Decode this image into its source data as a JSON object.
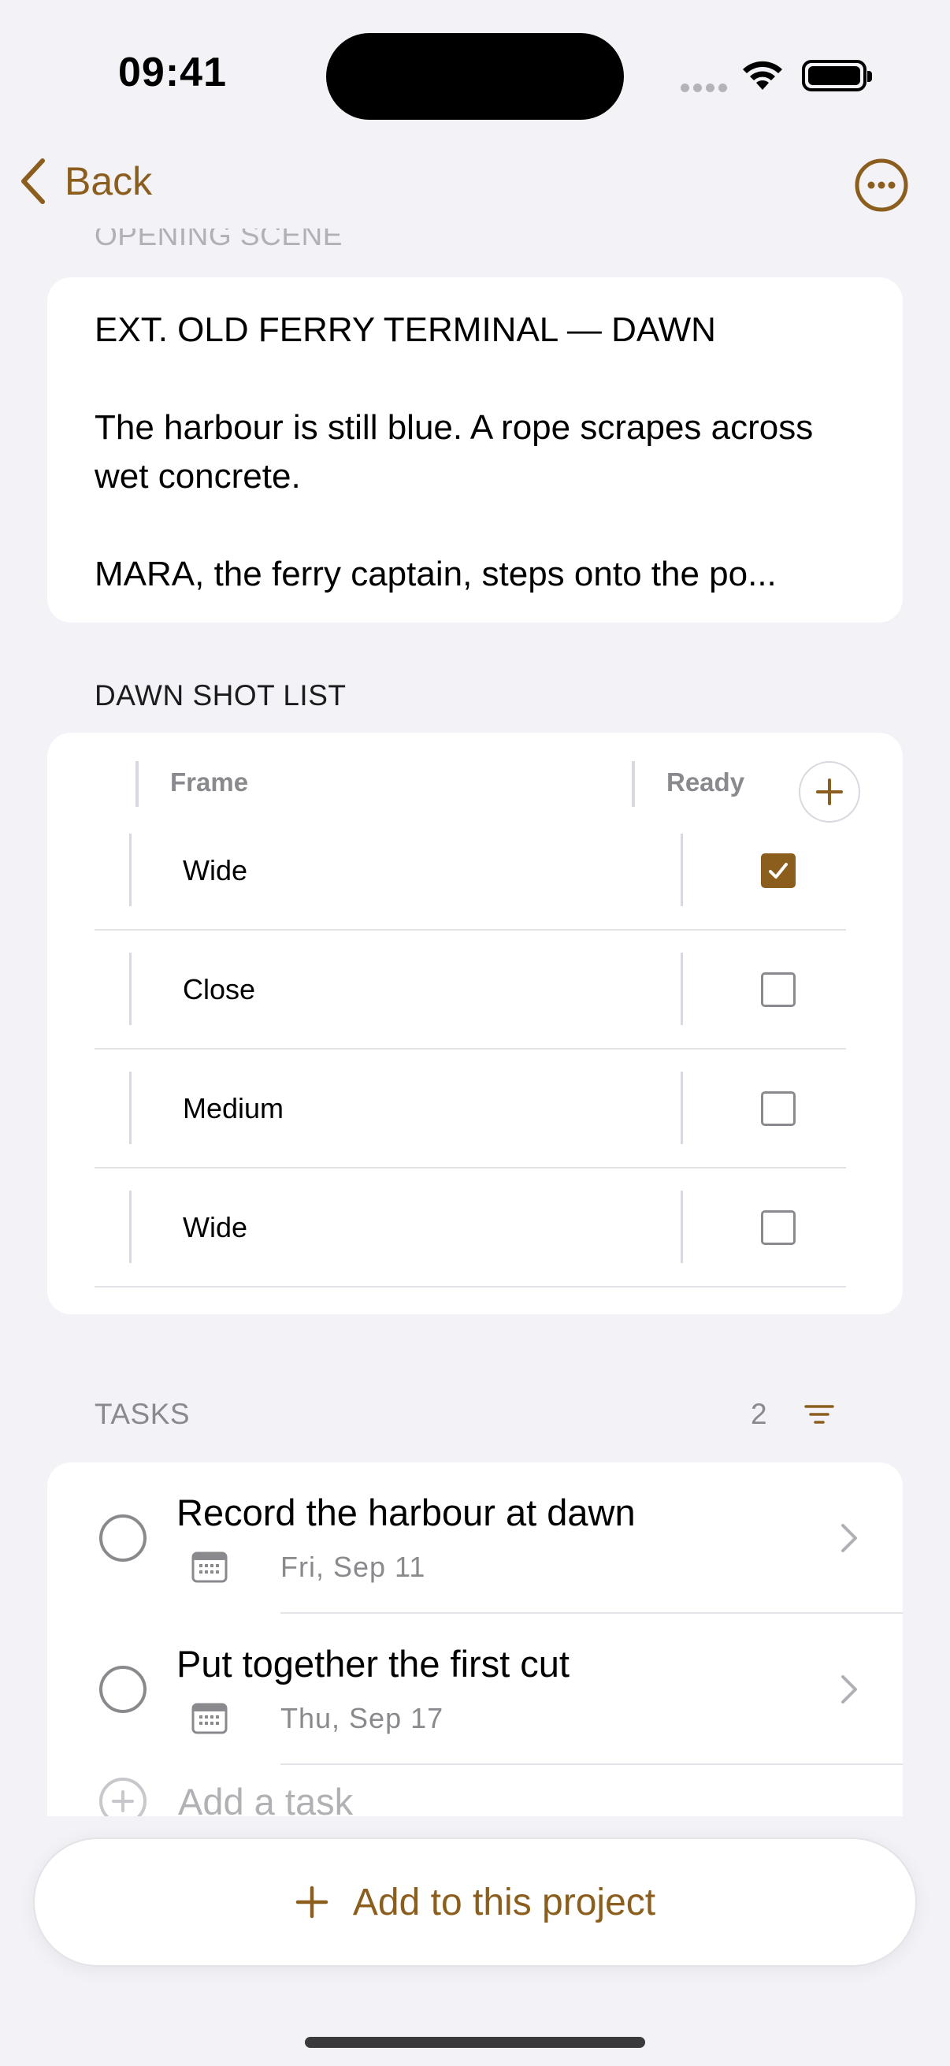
{
  "status_bar": {
    "time": "09:41"
  },
  "nav": {
    "back_label": "Back"
  },
  "opening_scene": {
    "header": "OPENING SCENE",
    "lines": [
      "EXT. OLD FERRY TERMINAL — DAWN",
      "The harbour is still blue. A rope scrapes across wet concrete.",
      "MARA, the ferry captain, steps onto the po..."
    ]
  },
  "shot_list": {
    "header": "DAWN SHOT LIST",
    "columns": [
      "Frame",
      "Ready"
    ],
    "rows": [
      {
        "frame": "Wide",
        "ready": true
      },
      {
        "frame": "Close",
        "ready": false
      },
      {
        "frame": "Medium",
        "ready": false
      },
      {
        "frame": "Wide",
        "ready": false
      }
    ]
  },
  "tasks": {
    "header": "TASKS",
    "count": "2",
    "items": [
      {
        "title": "Record the harbour at dawn",
        "date": "Fri, Sep 11"
      },
      {
        "title": "Put together the first cut",
        "date": "Thu, Sep 17"
      }
    ],
    "add_label": "Add a task"
  },
  "footer": {
    "add_button_label": "Add to this project"
  },
  "colors": {
    "accent": "#8b5e1e",
    "background": "#f2f2f7"
  }
}
